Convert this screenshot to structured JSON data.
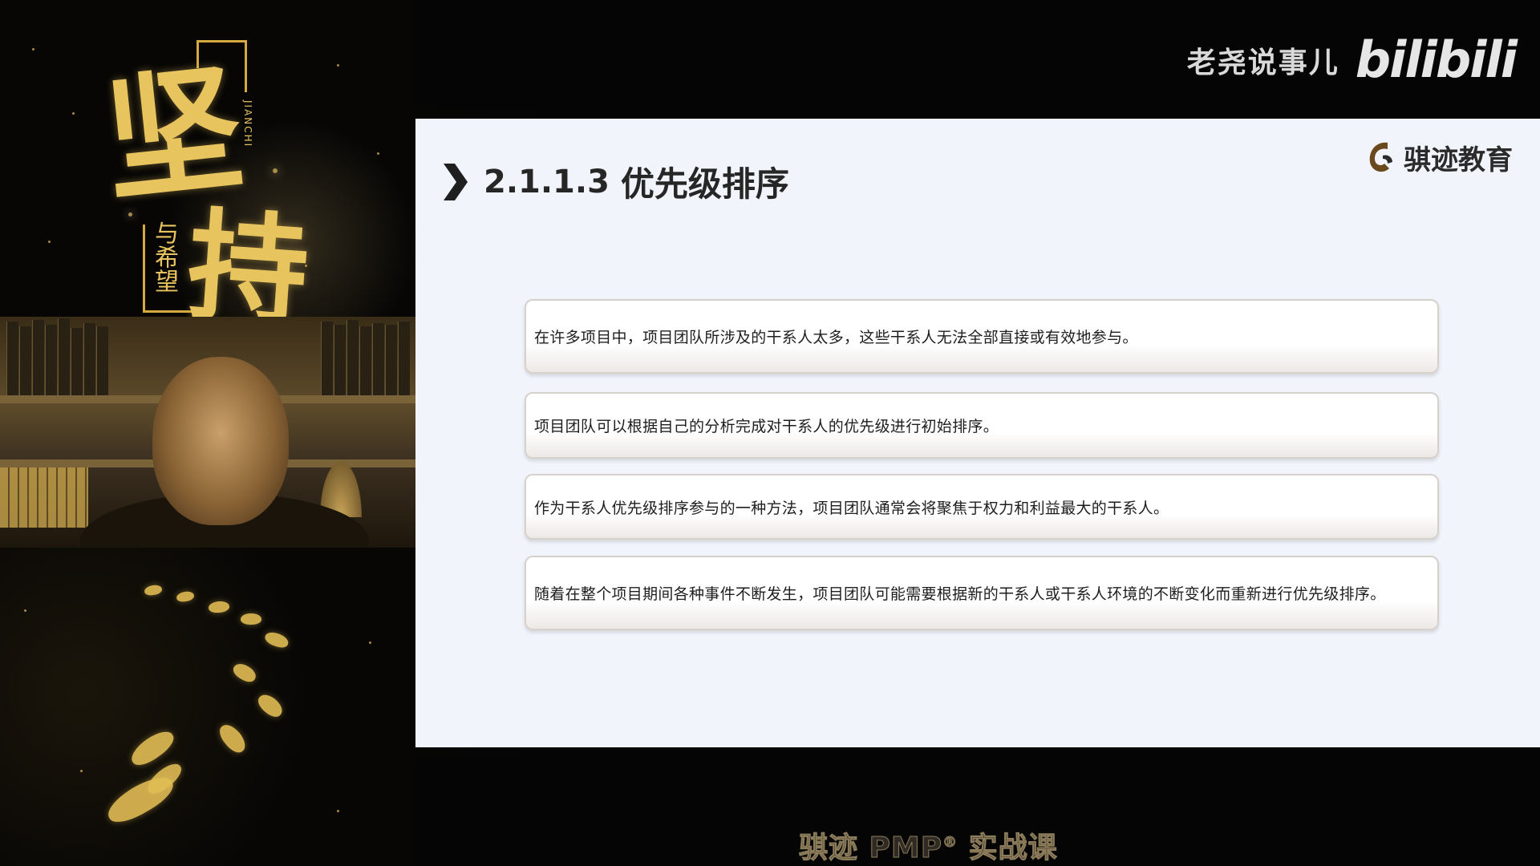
{
  "channel": {
    "name": "老尧说事儿",
    "platform": "bilibili"
  },
  "poster": {
    "title_char_1": "坚",
    "title_char_2": "持",
    "subtitle": "与希望",
    "pinyin": "JIANCHI"
  },
  "slide": {
    "section_number": "2.1.1.3",
    "title": "优先级排序",
    "org_name": "骐迹教育",
    "points": [
      "在许多项目中，项目团队所涉及的干系人太多，这些干系人无法全部直接或有效地参与。",
      "项目团队可以根据自己的分析完成对干系人的优先级进行初始排序。",
      "作为干系人优先级排序参与的一种方法，项目团队通常会将聚焦于权力和利益最大的干系人。",
      "随着在整个项目期间各种事件不断发生，项目团队可能需要根据新的干系人或干系人环境的不断变化而重新进行优先级排序。"
    ]
  },
  "course": {
    "title_prefix": "骐迹 PMP",
    "registered_mark": "®",
    "title_suffix": " 实战课"
  },
  "colors": {
    "gold": "#e8c45e",
    "slide_bg": "#f1f4fb",
    "text_dark": "#262626"
  }
}
